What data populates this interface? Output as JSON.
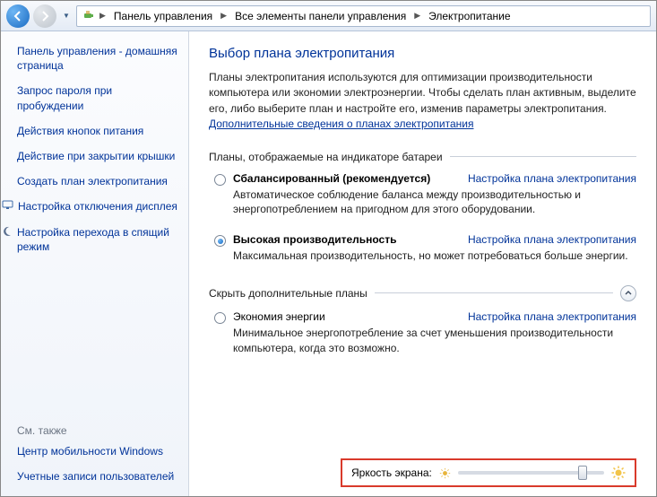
{
  "nav": {
    "breadcrumb": [
      "Панель управления",
      "Все элементы панели управления",
      "Электропитание"
    ]
  },
  "sidebar": {
    "links": [
      "Панель управления - домашняя страница",
      "Запрос пароля при пробуждении",
      "Действия кнопок питания",
      "Действие при закрытии крышки",
      "Создать план электропитания",
      "Настройка отключения дисплея",
      "Настройка перехода в спящий режим"
    ],
    "see_also_header": "См. также",
    "see_also": [
      "Центр мобильности Windows",
      "Учетные записи пользователей"
    ]
  },
  "main": {
    "title": "Выбор плана электропитания",
    "intro_a": "Планы электропитания используются для оптимизации производительности компьютера или экономии электроэнергии. Чтобы сделать план активным, выделите его, либо выберите план и настройте его, изменив параметры электропитания. ",
    "intro_link": "Дополнительные сведения о планах электропитания",
    "group_battery": "Планы, отображаемые на индикаторе батареи",
    "plan_settings_link": "Настройка плана электропитания",
    "plans_battery": [
      {
        "name": "Сбалансированный (рекомендуется)",
        "checked": false,
        "desc": "Автоматическое соблюдение баланса между производительностью и энергопотреблением на пригодном для этого оборудовании."
      },
      {
        "name": "Высокая производительность",
        "checked": true,
        "desc": "Максимальная производительность, но может потребоваться больше энергии."
      }
    ],
    "group_extra": "Скрыть дополнительные планы",
    "plans_extra": [
      {
        "name": "Экономия энергии",
        "checked": false,
        "desc": "Минимальное энергопотребление за счет уменьшения производительности компьютера, когда это возможно."
      }
    ],
    "brightness_label": "Яркость экрана:"
  }
}
